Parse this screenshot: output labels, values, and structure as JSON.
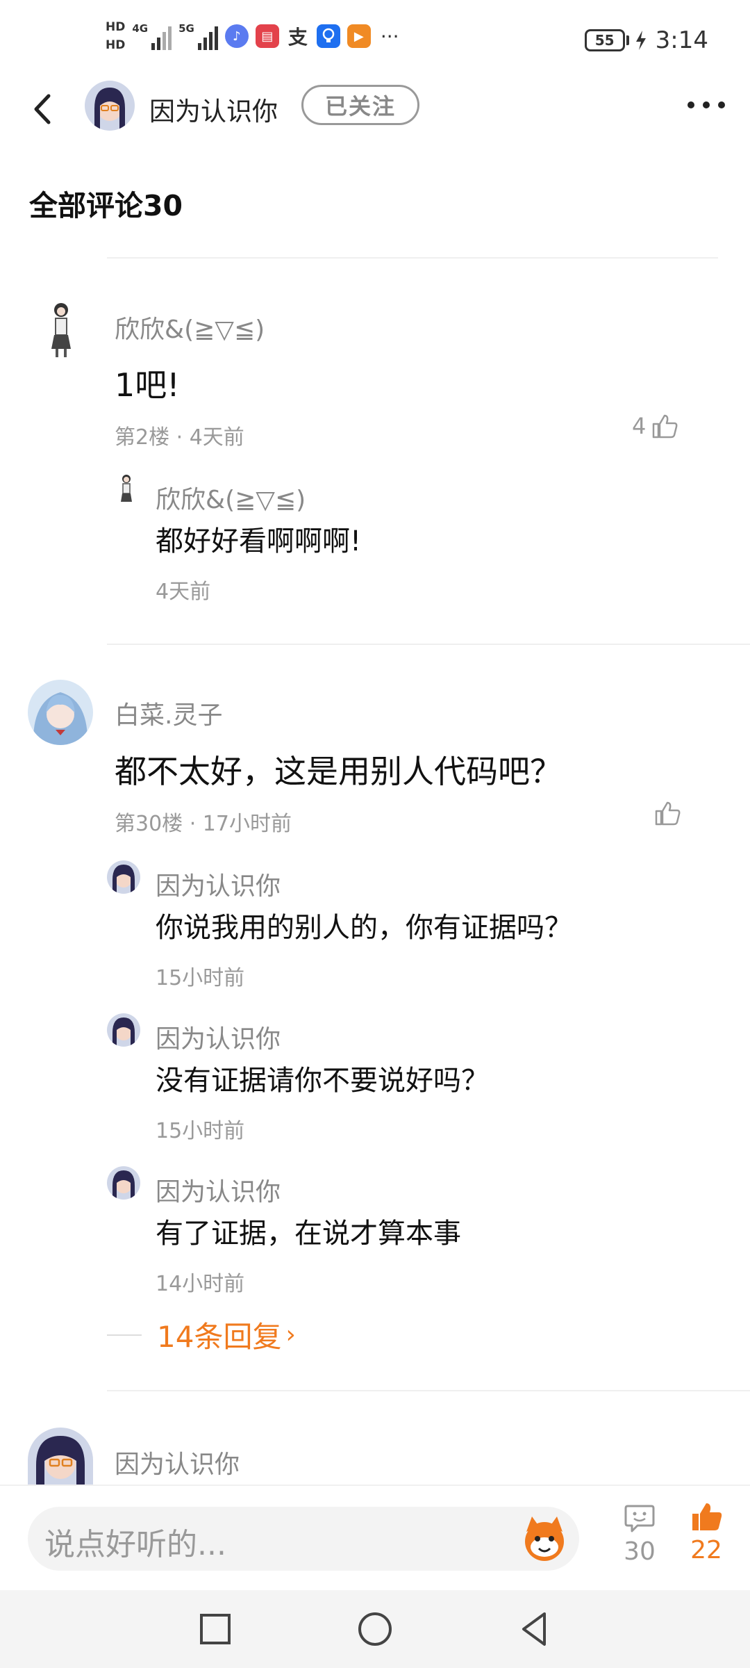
{
  "status_bar": {
    "hd1": "HD",
    "hd2": "HD",
    "net1": "4G",
    "net2": "5G",
    "battery": "55",
    "time": "3:14",
    "overflow": "···",
    "app_icons": [
      "music-icon",
      "reader-icon",
      "alipay-icon",
      "bulb-icon",
      "video-icon"
    ]
  },
  "header": {
    "name": "因为认识你",
    "follow_label": "已关注"
  },
  "section_title": "全部评论30",
  "comments": [
    {
      "user": "欣欣&(≧▽≦)",
      "text": "1吧!",
      "meta": "第2楼 · 4天前",
      "likes": "4",
      "replies": [
        {
          "user": "欣欣&(≧▽≦)",
          "text": "都好好看啊啊啊!",
          "time": "4天前"
        }
      ]
    },
    {
      "user": "白菜.灵子",
      "text": "都不太好，这是用别人代码吧？",
      "meta": "第30楼 · 17小时前",
      "likes": "",
      "replies": [
        {
          "user": "因为认识你",
          "text": "你说我用的别人的，你有证据吗？",
          "time": "15小时前"
        },
        {
          "user": "因为认识你",
          "text": "没有证据请你不要说好吗？",
          "time": "15小时前"
        },
        {
          "user": "因为认识你",
          "text": "有了证据，在说才算本事",
          "time": "14小时前"
        }
      ],
      "more_replies": "14条回复"
    },
    {
      "user": "因为认识你"
    }
  ],
  "bottom_bar": {
    "placeholder": "说点好听的...",
    "comment_count": "30",
    "like_count": "22"
  },
  "colors": {
    "accent": "#f07a1e",
    "muted": "#999999",
    "text": "#111111"
  }
}
